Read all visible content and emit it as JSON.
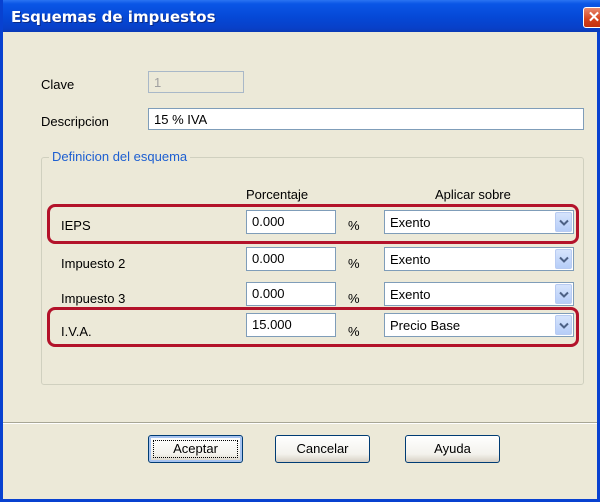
{
  "window": {
    "title": "Esquemas de impuestos",
    "close_symbol": "✕"
  },
  "form": {
    "clave_label": "Clave",
    "clave_value": "1",
    "descripcion_label": "Descripcion",
    "descripcion_value": "15 % IVA"
  },
  "group": {
    "title": "Definicion del esquema",
    "col_porcentaje": "Porcentaje",
    "col_aplicar": "Aplicar sobre",
    "rows": [
      {
        "name": "IEPS",
        "porcentaje": "0.000",
        "unit": "%",
        "aplicar": "Exento",
        "highlighted": true
      },
      {
        "name": "Impuesto 2",
        "porcentaje": "0.000",
        "unit": "%",
        "aplicar": "Exento",
        "highlighted": false
      },
      {
        "name": "Impuesto 3",
        "porcentaje": "0.000",
        "unit": "%",
        "aplicar": "Exento",
        "highlighted": false
      },
      {
        "name": "I.V.A.",
        "porcentaje": "15.000",
        "unit": "%",
        "aplicar": "Precio Base",
        "highlighted": true
      }
    ]
  },
  "buttons": {
    "aceptar": "Aceptar",
    "cancelar": "Cancelar",
    "ayuda": "Ayuda"
  },
  "colors": {
    "title_bar": "#0548d6",
    "highlight": "#b3122a",
    "group_title": "#1d5fd1",
    "window_bg": "#ece9d8"
  },
  "icons": {
    "dropdown": "chevron-down-icon",
    "close": "close-icon"
  }
}
